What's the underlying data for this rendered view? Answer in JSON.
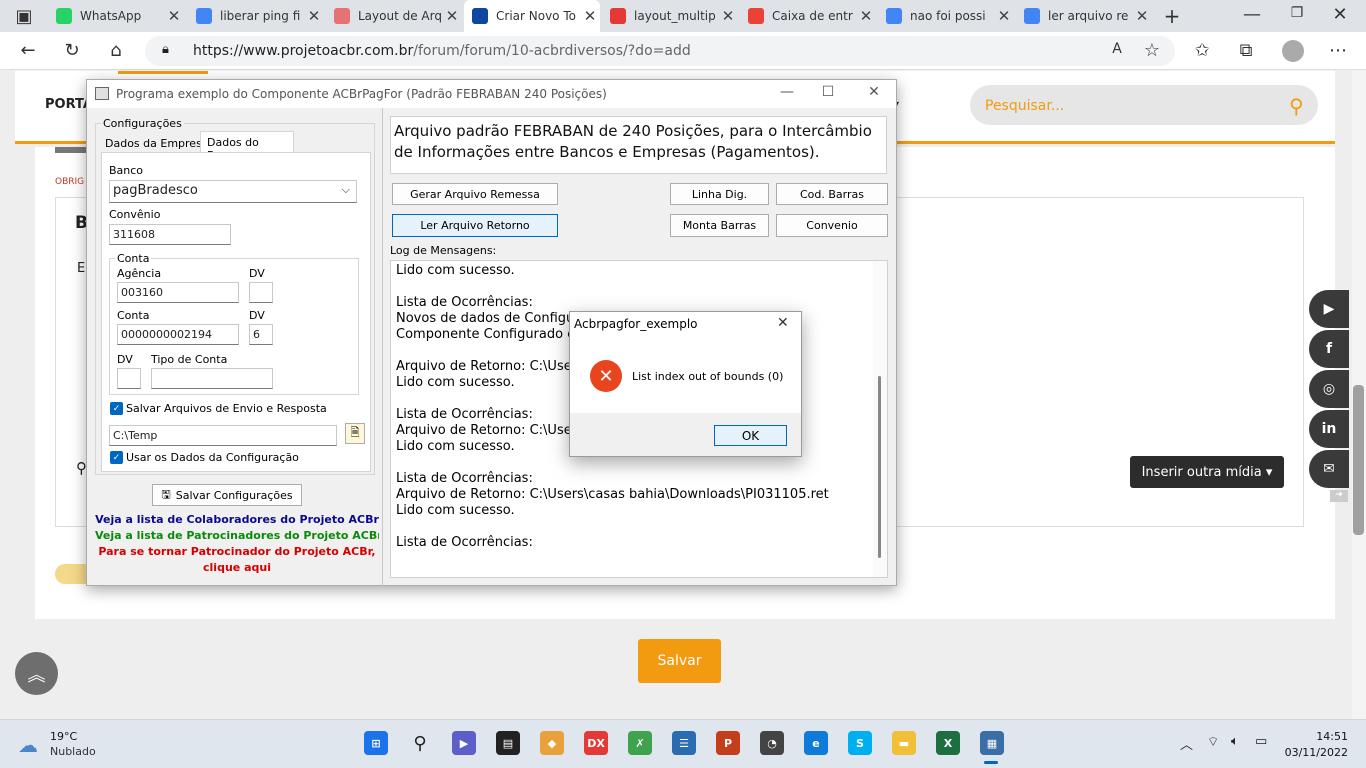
{
  "browser": {
    "tabs": [
      {
        "title": "WhatsApp",
        "icon": "whatsapp-icon",
        "color": "#25d366"
      },
      {
        "title": "liberar ping fi",
        "icon": "google-icon",
        "color": "#4285f4"
      },
      {
        "title": "Layout de Arq",
        "icon": "layout-icon",
        "color": "#e57373"
      },
      {
        "title": "Criar Novo To",
        "icon": "acbr-icon",
        "color": "#0d47a1"
      },
      {
        "title": "layout_multip",
        "icon": "pdf-icon",
        "color": "#e53935"
      },
      {
        "title": "Caixa de entr",
        "icon": "gmail-icon",
        "color": "#ea4335"
      },
      {
        "title": "nao foi possi",
        "icon": "google-icon",
        "color": "#4285f4"
      },
      {
        "title": "ler arquivo re",
        "icon": "google-icon",
        "color": "#4285f4"
      }
    ],
    "url_host": "https://www.projetoacbr.com.br",
    "url_path": "/forum/forum/10-acbrdiversos/?do=add"
  },
  "site": {
    "nav_label": "PORTA",
    "search_placeholder": "Pesquisar...",
    "required_hint": "OBRIG",
    "editor_heading_fragment": "B",
    "editor_text_fragment": "E",
    "media_button": "Inserir outra mídia",
    "save_button": "Salvar",
    "social_icons": [
      "youtube-icon",
      "facebook-icon",
      "instagram-icon",
      "linkedin-icon",
      "email-icon"
    ]
  },
  "app": {
    "title": "Programa exemplo do Componente ACBrPagFor (Padrão FEBRABAN 240 Posições)",
    "config_group": "Configurações",
    "tab_empresa": "Dados da Empresa",
    "tab_banco": "Dados do Banco",
    "banco_label": "Banco",
    "banco_value": "pagBradesco",
    "convenio_label": "Convênio",
    "convenio_value": "311608",
    "conta_group": "Conta",
    "agencia_label": "Agência",
    "agencia_value": "003160",
    "dv_label": "DV",
    "agencia_dv": "",
    "conta_label": "Conta",
    "conta_value": "0000000002194",
    "conta_dv": "6",
    "dv2_label": "DV",
    "tipo_conta_label": "Tipo de Conta",
    "salvar_arquivos_label": "Salvar Arquivos de Envio e Resposta",
    "path_value": "C:\\Temp",
    "usar_dados_label": "Usar os Dados da Configuração",
    "salvar_config_btn": "Salvar Configurações",
    "link_colaboradores": "Veja a lista de Colaboradores do Projeto ACBr",
    "link_patrocinadores": "Veja a lista de Patrocinadores do Projeto ACBr",
    "link_tornar_1": "Para se tornar Patrocinador do Projeto ACBr,",
    "link_tornar_2": "clique aqui",
    "description": "Arquivo padrão FEBRABAN de 240 Posições, para o Intercâmbio de Informações entre Bancos e Empresas (Pagamentos).",
    "btn_gerar": "Gerar Arquivo Remessa",
    "btn_ler": "Ler Arquivo Retorno",
    "btn_linha": "Linha Dig.",
    "btn_cod": "Cod. Barras",
    "btn_monta": "Monta Barras",
    "btn_convenio": "Convenio",
    "log_label": "Log de Mensagens:",
    "log_lines": [
      "Lido com sucesso.",
      "",
      "Lista de Ocorrências:",
      "Novos de dados de Configura",
      "Componente Configurado con",
      "",
      "Arquivo de Retorno: C:\\Users\\",
      "Lido com sucesso.",
      "",
      "Lista de Ocorrências:",
      "Arquivo de Retorno: C:\\Users\\",
      "Lido com sucesso.",
      "",
      "Lista de Ocorrências:",
      "Arquivo de Retorno: C:\\Users\\casas bahia\\Downloads\\PI031105.ret",
      "Lido com sucesso.",
      "",
      "Lista de Ocorrências:"
    ]
  },
  "dialog": {
    "title": "Acbrpagfor_exemplo",
    "message": "List index out of bounds (0)",
    "ok": "OK"
  },
  "taskbar": {
    "temp": "19°C",
    "weather": "Nublado",
    "time": "14:51",
    "date": "03/11/2022",
    "apps": [
      "start-icon",
      "search-icon",
      "meet-icon",
      "terminal-icon",
      "app-icon",
      "devexpress-icon",
      "tools-icon",
      "notes-icon",
      "powerpoint-icon",
      "app2-icon",
      "edge-icon",
      "skype-icon",
      "explorer-icon",
      "excel-icon",
      "acbr-app-icon"
    ]
  }
}
